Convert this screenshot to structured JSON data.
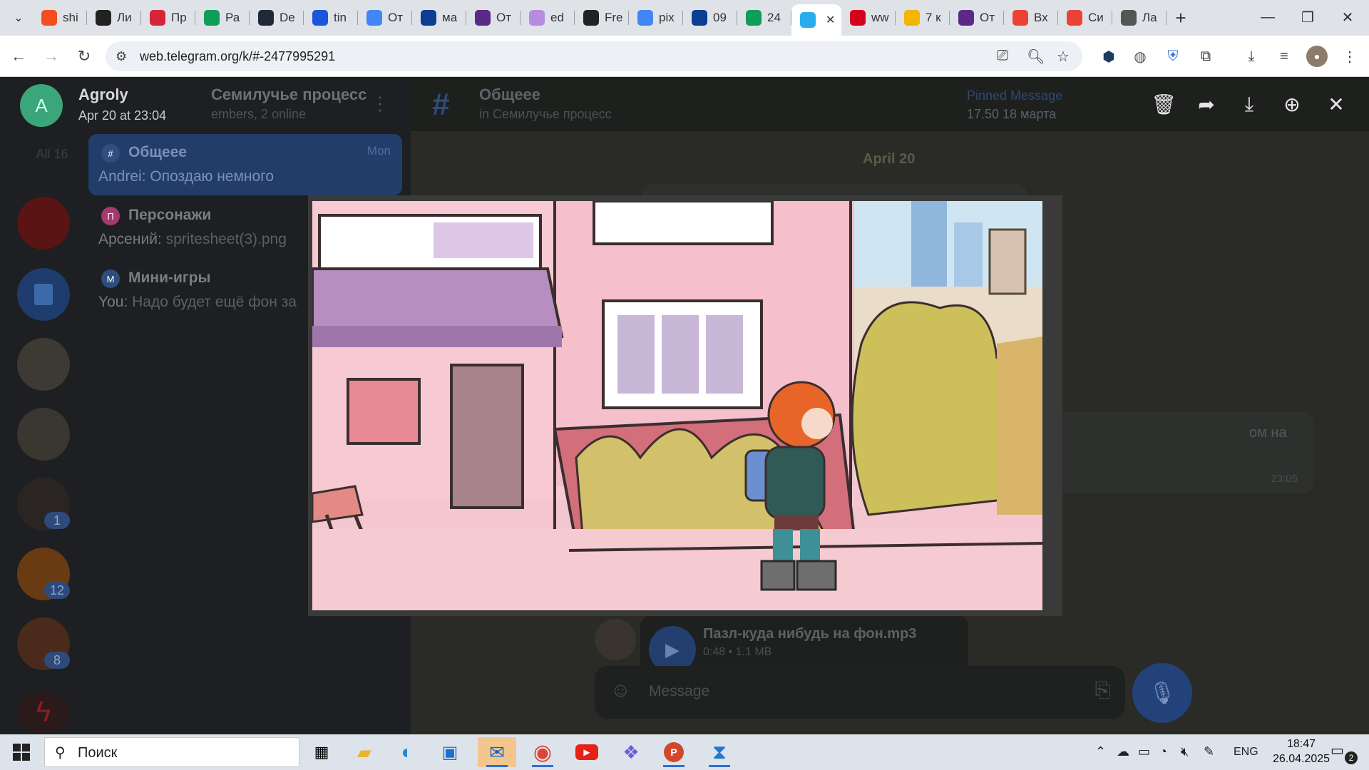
{
  "browser": {
    "tabs": [
      {
        "label": "shi",
        "icon": "figma-icon",
        "color": "#f24e1e"
      },
      {
        "label": "Ли",
        "icon": "circle-icon",
        "color": "#222222"
      },
      {
        "label": "Пр",
        "icon": "lingualeo-icon",
        "color": "#d6243a"
      },
      {
        "label": "Ра",
        "icon": "sheets-plus-icon",
        "color": "#0f9d58"
      },
      {
        "label": "De",
        "icon": "deepseek-icon",
        "color": "#1f2937"
      },
      {
        "label": "tin",
        "icon": "s-icon",
        "color": "#1a56db"
      },
      {
        "label": "От",
        "icon": "question-icon",
        "color": "#4285f4"
      },
      {
        "label": "ма",
        "icon": "m-icon",
        "color": "#0b3d91"
      },
      {
        "label": "От",
        "icon": "bolt-icon",
        "color": "#5b2a86"
      },
      {
        "label": "ed",
        "icon": "brush-icon",
        "color": "#b58ce0"
      },
      {
        "label": "Fre",
        "icon": "fre-icon",
        "color": "#222222"
      },
      {
        "label": "pix",
        "icon": "google-icon",
        "color": "#4285f4"
      },
      {
        "label": "09",
        "icon": "d-icon",
        "color": "#0b3d91"
      },
      {
        "label": "24",
        "icon": "sheets-plus-icon",
        "color": "#0f9d58"
      },
      {
        "label": "",
        "icon": "telegram-icon",
        "color": "#2aabee",
        "active": true
      },
      {
        "label": "ww",
        "icon": "hh-icon",
        "color": "#d6001c"
      },
      {
        "label": "7 к",
        "icon": "smiley-icon",
        "color": "#f4b400"
      },
      {
        "label": "От",
        "icon": "bolt-icon",
        "color": "#5b2a86"
      },
      {
        "label": "Вх",
        "icon": "gmail-icon",
        "color": "#ea4335"
      },
      {
        "label": "Си",
        "icon": "gmail-icon",
        "color": "#ea4335"
      },
      {
        "label": "Ла",
        "icon": "globe-icon",
        "color": "#555555"
      }
    ],
    "url": "web.telegram.org/k/#-2477995291"
  },
  "telegram": {
    "group_title": "Семилучье процесс",
    "group_members": "embers, 2 online",
    "topics": [
      {
        "name": "Общеее",
        "snippet": "Andrei: Опоздаю немного",
        "time": "Mon",
        "active": true,
        "dot_color": "#2f4d7d",
        "dot_label": "#"
      },
      {
        "name": "Персонажи",
        "snippet_prefix": "Арсений:",
        "snippet": "spritesheet(3).png",
        "dot_color": "#a23a6e",
        "dot_label": "П"
      },
      {
        "name": "Мини-игры",
        "snippet_prefix": "You:",
        "snippet": "Надо будет ещё фон за",
        "dot_color": "#2f4d7d",
        "dot_label": "М"
      }
    ],
    "rail_badges": [
      "All 16",
      "1",
      "12",
      "8"
    ],
    "chat_title": "Общеее",
    "chat_subtitle": "in Семилучье процесс",
    "pinned_label": "Pinned Message",
    "pinned_text": "17.50 18 марта",
    "date_pill": "April 20",
    "msg_fragment": "ом на",
    "msg_time": "23:05",
    "audio_title": "Пазл-куда нибудь на фон.mp3",
    "audio_meta": "0:48 • 1.1 MB",
    "composer_placeholder": "Message"
  },
  "viewer": {
    "author": "Agroly",
    "date": "Apr 20 at 23:04",
    "avatar_letter": "A"
  },
  "taskbar": {
    "search_placeholder": "Поиск",
    "language": "ENG",
    "time": "18:47",
    "date": "26.04.2025",
    "notification_count": "2"
  }
}
